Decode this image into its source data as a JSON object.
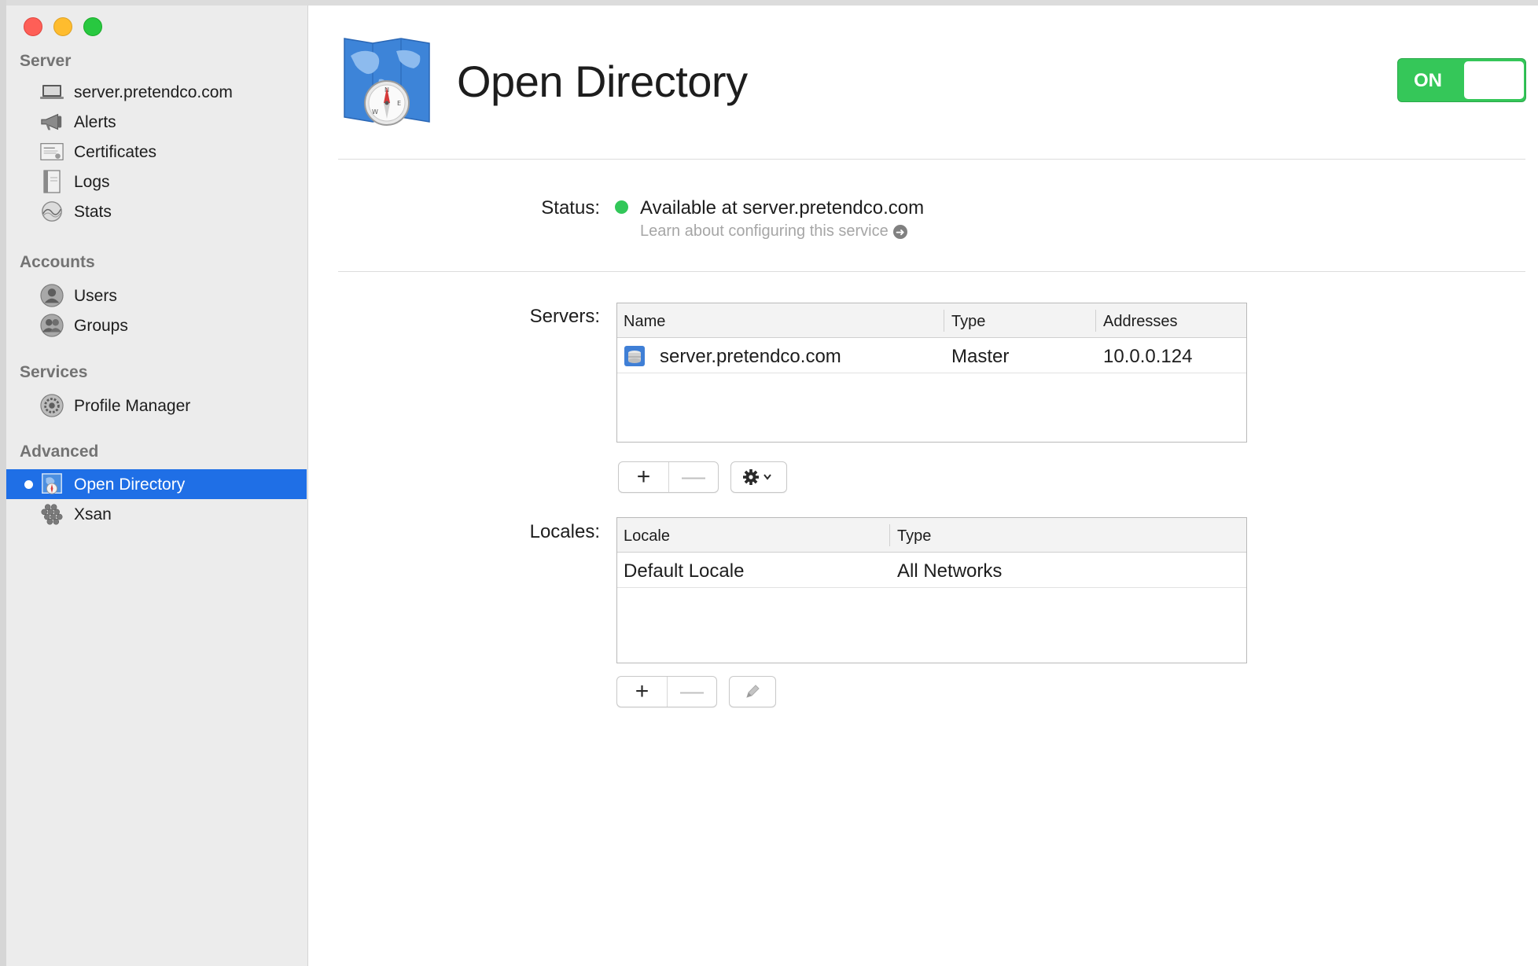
{
  "window": {
    "controls": [
      "close",
      "minimize",
      "maximize"
    ]
  },
  "sidebar": {
    "sections": [
      {
        "header": "Server",
        "items": [
          {
            "label": "server.pretendco.com",
            "icon": "laptop-icon"
          },
          {
            "label": "Alerts",
            "icon": "megaphone-icon"
          },
          {
            "label": "Certificates",
            "icon": "certificate-icon"
          },
          {
            "label": "Logs",
            "icon": "log-book-icon"
          },
          {
            "label": "Stats",
            "icon": "stats-graph-icon"
          }
        ]
      },
      {
        "header": "Accounts",
        "items": [
          {
            "label": "Users",
            "icon": "user-icon"
          },
          {
            "label": "Groups",
            "icon": "group-icon"
          }
        ]
      },
      {
        "header": "Services",
        "items": [
          {
            "label": "Profile Manager",
            "icon": "profile-manager-gear-icon"
          }
        ]
      },
      {
        "header": "Advanced",
        "items": [
          {
            "label": "Open Directory",
            "icon": "open-directory-icon",
            "selected": true
          },
          {
            "label": "Xsan",
            "icon": "xsan-icon"
          }
        ]
      }
    ]
  },
  "header": {
    "title": "Open Directory",
    "icon": "open-directory-compass-map-icon",
    "toggle_label": "ON",
    "toggle_state": "on"
  },
  "status": {
    "label": "Status:",
    "text": "Available at server.pretendco.com",
    "indicator_color": "#32c759",
    "learn_link": "Learn about configuring this service"
  },
  "servers": {
    "label": "Servers:",
    "columns": [
      "Name",
      "Type",
      "Addresses"
    ],
    "rows": [
      {
        "name": "server.pretendco.com",
        "type": "Master",
        "addresses": "10.0.0.124"
      }
    ],
    "buttons": {
      "add": "+",
      "remove": "—",
      "action": "gear-menu"
    }
  },
  "locales": {
    "label": "Locales:",
    "columns": [
      "Locale",
      "Type"
    ],
    "rows": [
      {
        "locale": "Default Locale",
        "type": "All Networks"
      }
    ],
    "buttons": {
      "add": "+",
      "remove": "—",
      "edit": "pencil"
    }
  },
  "colors": {
    "accent": "#1f6fe6",
    "toggle_on": "#35c759"
  }
}
